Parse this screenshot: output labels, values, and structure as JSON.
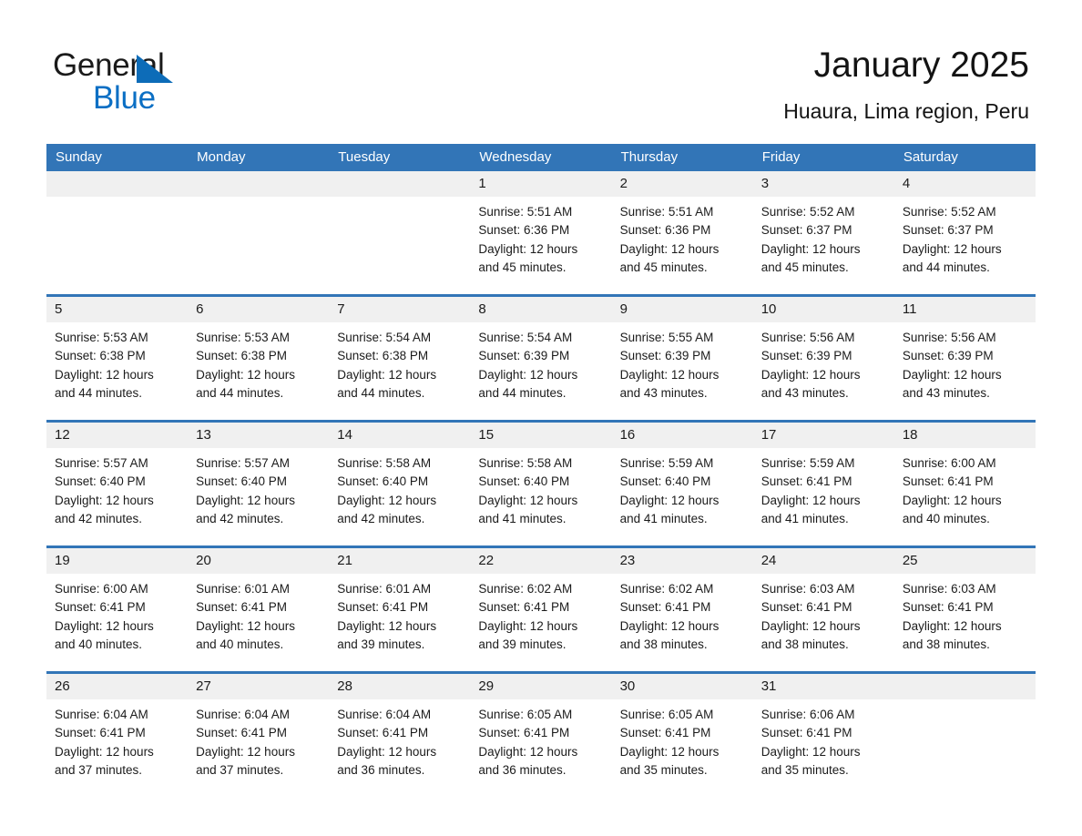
{
  "brand": {
    "name_part1": "General",
    "name_part2": "Blue",
    "accent_color": "#0b6fc4",
    "triangle_icon": "triangle-icon"
  },
  "header": {
    "title": "January 2025",
    "subtitle": "Huaura, Lima region, Peru"
  },
  "calendar": {
    "header_color": "#3275b7",
    "day_band_color": "#f0f0f0",
    "weekday_headers": [
      "Sunday",
      "Monday",
      "Tuesday",
      "Wednesday",
      "Thursday",
      "Friday",
      "Saturday"
    ],
    "weeks": [
      [
        {
          "date": "",
          "lines": []
        },
        {
          "date": "",
          "lines": []
        },
        {
          "date": "",
          "lines": []
        },
        {
          "date": "1",
          "lines": [
            "Sunrise: 5:51 AM",
            "Sunset: 6:36 PM",
            "Daylight: 12 hours",
            "and 45 minutes."
          ]
        },
        {
          "date": "2",
          "lines": [
            "Sunrise: 5:51 AM",
            "Sunset: 6:36 PM",
            "Daylight: 12 hours",
            "and 45 minutes."
          ]
        },
        {
          "date": "3",
          "lines": [
            "Sunrise: 5:52 AM",
            "Sunset: 6:37 PM",
            "Daylight: 12 hours",
            "and 45 minutes."
          ]
        },
        {
          "date": "4",
          "lines": [
            "Sunrise: 5:52 AM",
            "Sunset: 6:37 PM",
            "Daylight: 12 hours",
            "and 44 minutes."
          ]
        }
      ],
      [
        {
          "date": "5",
          "lines": [
            "Sunrise: 5:53 AM",
            "Sunset: 6:38 PM",
            "Daylight: 12 hours",
            "and 44 minutes."
          ]
        },
        {
          "date": "6",
          "lines": [
            "Sunrise: 5:53 AM",
            "Sunset: 6:38 PM",
            "Daylight: 12 hours",
            "and 44 minutes."
          ]
        },
        {
          "date": "7",
          "lines": [
            "Sunrise: 5:54 AM",
            "Sunset: 6:38 PM",
            "Daylight: 12 hours",
            "and 44 minutes."
          ]
        },
        {
          "date": "8",
          "lines": [
            "Sunrise: 5:54 AM",
            "Sunset: 6:39 PM",
            "Daylight: 12 hours",
            "and 44 minutes."
          ]
        },
        {
          "date": "9",
          "lines": [
            "Sunrise: 5:55 AM",
            "Sunset: 6:39 PM",
            "Daylight: 12 hours",
            "and 43 minutes."
          ]
        },
        {
          "date": "10",
          "lines": [
            "Sunrise: 5:56 AM",
            "Sunset: 6:39 PM",
            "Daylight: 12 hours",
            "and 43 minutes."
          ]
        },
        {
          "date": "11",
          "lines": [
            "Sunrise: 5:56 AM",
            "Sunset: 6:39 PM",
            "Daylight: 12 hours",
            "and 43 minutes."
          ]
        }
      ],
      [
        {
          "date": "12",
          "lines": [
            "Sunrise: 5:57 AM",
            "Sunset: 6:40 PM",
            "Daylight: 12 hours",
            "and 42 minutes."
          ]
        },
        {
          "date": "13",
          "lines": [
            "Sunrise: 5:57 AM",
            "Sunset: 6:40 PM",
            "Daylight: 12 hours",
            "and 42 minutes."
          ]
        },
        {
          "date": "14",
          "lines": [
            "Sunrise: 5:58 AM",
            "Sunset: 6:40 PM",
            "Daylight: 12 hours",
            "and 42 minutes."
          ]
        },
        {
          "date": "15",
          "lines": [
            "Sunrise: 5:58 AM",
            "Sunset: 6:40 PM",
            "Daylight: 12 hours",
            "and 41 minutes."
          ]
        },
        {
          "date": "16",
          "lines": [
            "Sunrise: 5:59 AM",
            "Sunset: 6:40 PM",
            "Daylight: 12 hours",
            "and 41 minutes."
          ]
        },
        {
          "date": "17",
          "lines": [
            "Sunrise: 5:59 AM",
            "Sunset: 6:41 PM",
            "Daylight: 12 hours",
            "and 41 minutes."
          ]
        },
        {
          "date": "18",
          "lines": [
            "Sunrise: 6:00 AM",
            "Sunset: 6:41 PM",
            "Daylight: 12 hours",
            "and 40 minutes."
          ]
        }
      ],
      [
        {
          "date": "19",
          "lines": [
            "Sunrise: 6:00 AM",
            "Sunset: 6:41 PM",
            "Daylight: 12 hours",
            "and 40 minutes."
          ]
        },
        {
          "date": "20",
          "lines": [
            "Sunrise: 6:01 AM",
            "Sunset: 6:41 PM",
            "Daylight: 12 hours",
            "and 40 minutes."
          ]
        },
        {
          "date": "21",
          "lines": [
            "Sunrise: 6:01 AM",
            "Sunset: 6:41 PM",
            "Daylight: 12 hours",
            "and 39 minutes."
          ]
        },
        {
          "date": "22",
          "lines": [
            "Sunrise: 6:02 AM",
            "Sunset: 6:41 PM",
            "Daylight: 12 hours",
            "and 39 minutes."
          ]
        },
        {
          "date": "23",
          "lines": [
            "Sunrise: 6:02 AM",
            "Sunset: 6:41 PM",
            "Daylight: 12 hours",
            "and 38 minutes."
          ]
        },
        {
          "date": "24",
          "lines": [
            "Sunrise: 6:03 AM",
            "Sunset: 6:41 PM",
            "Daylight: 12 hours",
            "and 38 minutes."
          ]
        },
        {
          "date": "25",
          "lines": [
            "Sunrise: 6:03 AM",
            "Sunset: 6:41 PM",
            "Daylight: 12 hours",
            "and 38 minutes."
          ]
        }
      ],
      [
        {
          "date": "26",
          "lines": [
            "Sunrise: 6:04 AM",
            "Sunset: 6:41 PM",
            "Daylight: 12 hours",
            "and 37 minutes."
          ]
        },
        {
          "date": "27",
          "lines": [
            "Sunrise: 6:04 AM",
            "Sunset: 6:41 PM",
            "Daylight: 12 hours",
            "and 37 minutes."
          ]
        },
        {
          "date": "28",
          "lines": [
            "Sunrise: 6:04 AM",
            "Sunset: 6:41 PM",
            "Daylight: 12 hours",
            "and 36 minutes."
          ]
        },
        {
          "date": "29",
          "lines": [
            "Sunrise: 6:05 AM",
            "Sunset: 6:41 PM",
            "Daylight: 12 hours",
            "and 36 minutes."
          ]
        },
        {
          "date": "30",
          "lines": [
            "Sunrise: 6:05 AM",
            "Sunset: 6:41 PM",
            "Daylight: 12 hours",
            "and 35 minutes."
          ]
        },
        {
          "date": "31",
          "lines": [
            "Sunrise: 6:06 AM",
            "Sunset: 6:41 PM",
            "Daylight: 12 hours",
            "and 35 minutes."
          ]
        },
        {
          "date": "",
          "lines": []
        }
      ]
    ]
  }
}
